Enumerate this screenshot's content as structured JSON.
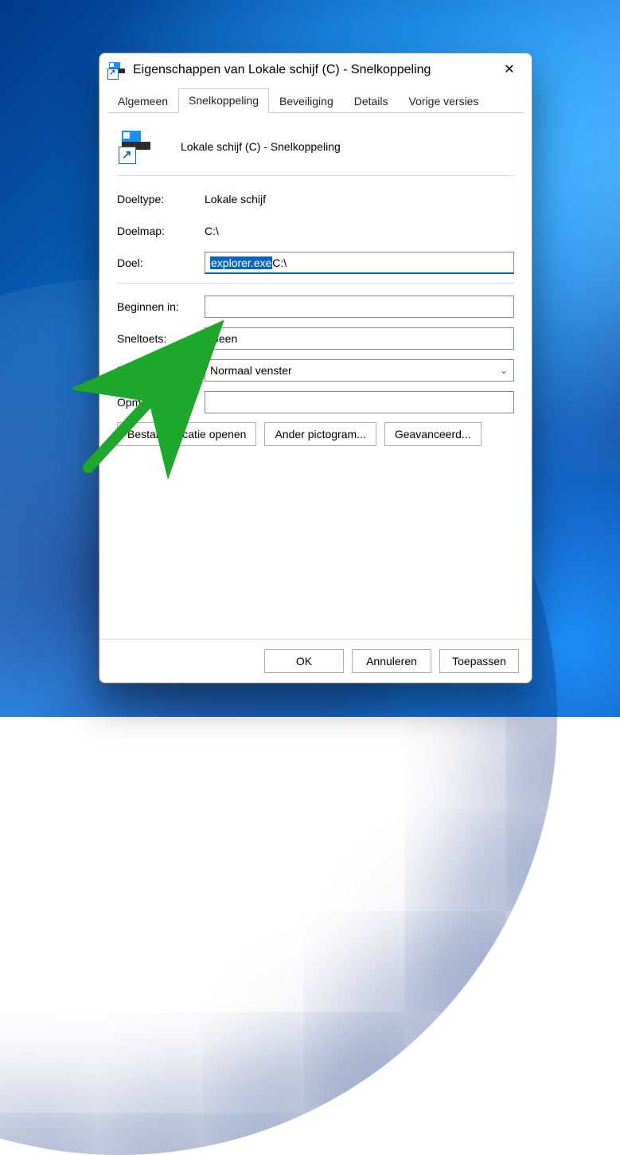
{
  "window": {
    "title": "Eigenschappen van Lokale schijf (C) - Snelkoppeling"
  },
  "tabs": [
    "Algemeen",
    "Snelkoppeling",
    "Beveiliging",
    "Details",
    "Vorige versies"
  ],
  "active_tab": 1,
  "header": {
    "name": "Lokale schijf (C) - Snelkoppeling"
  },
  "fields": {
    "target_type": {
      "label": "Doeltype:",
      "value": "Lokale schijf"
    },
    "target_dir": {
      "label": "Doelmap:",
      "value": "C:\\"
    },
    "target": {
      "label": "Doel:",
      "highlight": "explorer.exe",
      "rest": " C:\\"
    },
    "start_in": {
      "label": "Beginnen in:",
      "value": ""
    },
    "shortcut_key": {
      "label": "Sneltoets:",
      "value": "Geen"
    },
    "run": {
      "label": "Uitvoeren:",
      "value": "Normaal venster"
    },
    "comment": {
      "label": "Opmerking:",
      "value": ""
    }
  },
  "row_buttons": {
    "open_location": "Bestandslocatie openen",
    "change_icon": "Ander pictogram...",
    "advanced": "Geavanceerd..."
  },
  "footer": {
    "ok": "OK",
    "cancel": "Annuleren",
    "apply": "Toepassen"
  }
}
